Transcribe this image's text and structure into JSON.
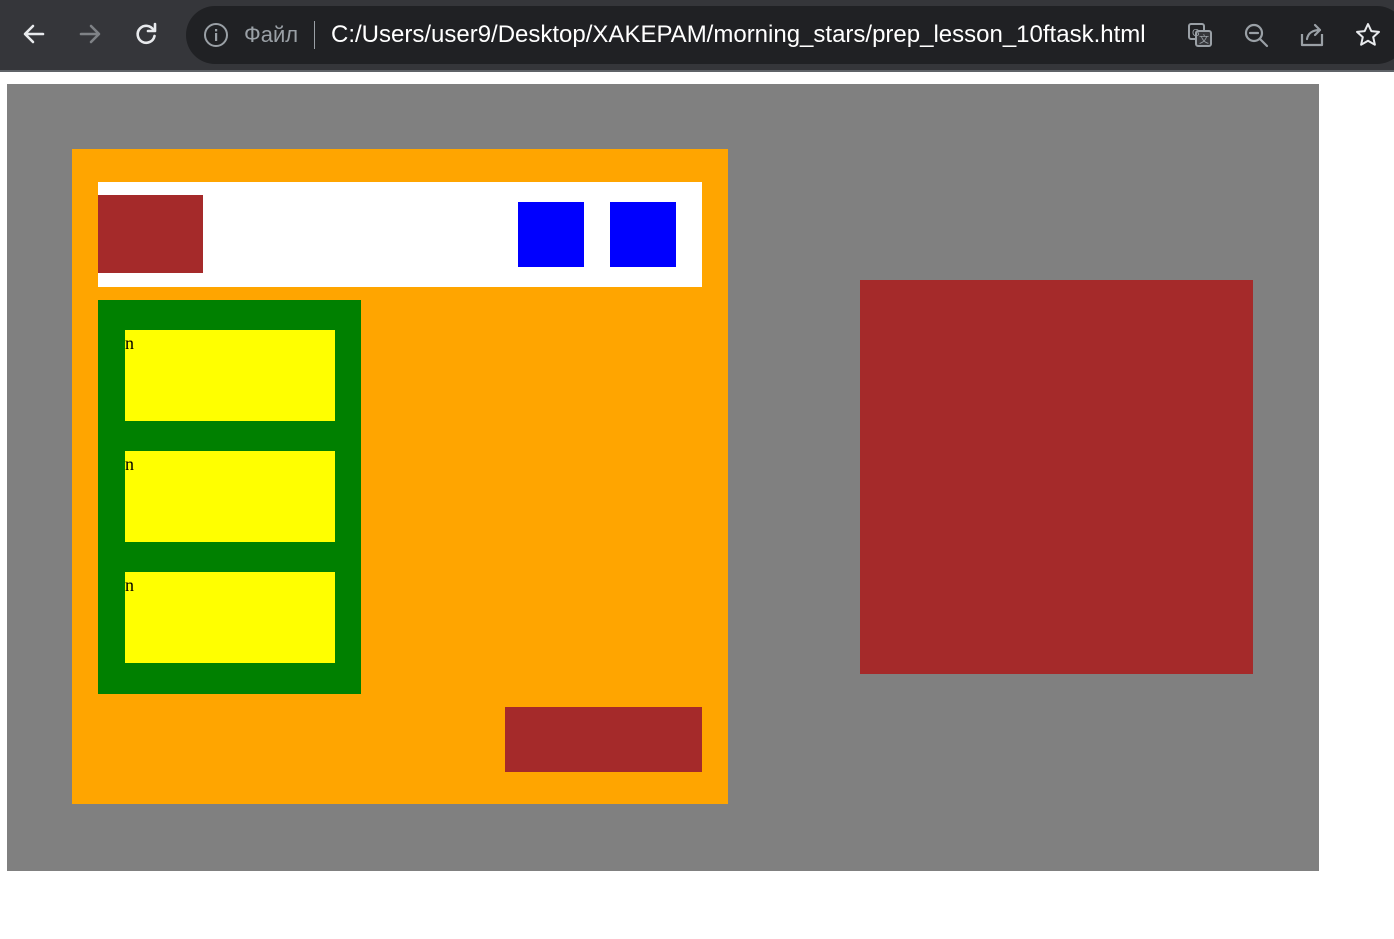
{
  "browser": {
    "file_label": "Файл",
    "url": "C:/Users/user9/Desktop/XAKEPAM/morning_stars/prep_lesson_10ftask.html",
    "nav_icons": [
      "back-arrow-icon",
      "forward-arrow-icon",
      "reload-icon"
    ],
    "omnibox_icons": [
      "info-icon",
      "translate-icon",
      "zoom-out-icon",
      "share-icon",
      "bookmark-star-icon"
    ]
  },
  "page": {
    "cards": [
      {
        "label": "n"
      },
      {
        "label": "n"
      },
      {
        "label": "n"
      }
    ],
    "colors": {
      "stage": "#808080",
      "panel": "#ffa500",
      "header": "#ffffff",
      "brown_block": "#a52a2a",
      "blue_button": "#0000ff",
      "sidebar": "#008000",
      "card": "#ffff00"
    }
  }
}
